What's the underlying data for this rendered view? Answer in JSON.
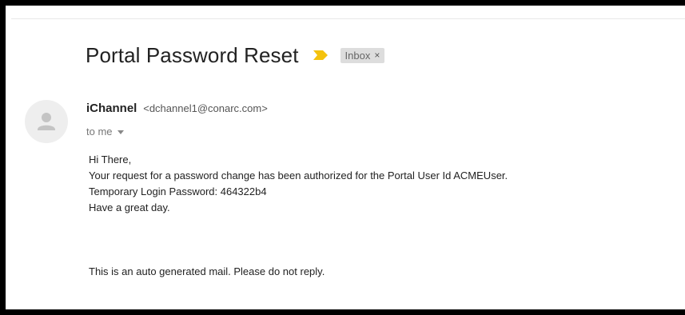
{
  "email": {
    "subject": "Portal Password Reset",
    "label": {
      "name": "Inbox",
      "remove": "×"
    },
    "sender": {
      "name": "iChannel",
      "address": "<dchannel1@conarc.com>"
    },
    "recipient": "to me",
    "body_lines": [
      "Hi There,",
      "Your request for a password change has been authorized for the Portal User Id ACMEUser.",
      "Temporary Login Password: 464322b4",
      "Have a great day."
    ],
    "footer": "This is an auto generated mail. Please do not reply."
  },
  "icons": {
    "importance": "importance-marker-icon",
    "avatar": "default-avatar-icon",
    "details_toggle": "chevron-down-icon"
  },
  "colors": {
    "importance_marker": "#f4c20d",
    "avatar_bg": "#eeeeee",
    "avatar_fg": "#c4c4c4",
    "label_bg": "#dddddd"
  }
}
